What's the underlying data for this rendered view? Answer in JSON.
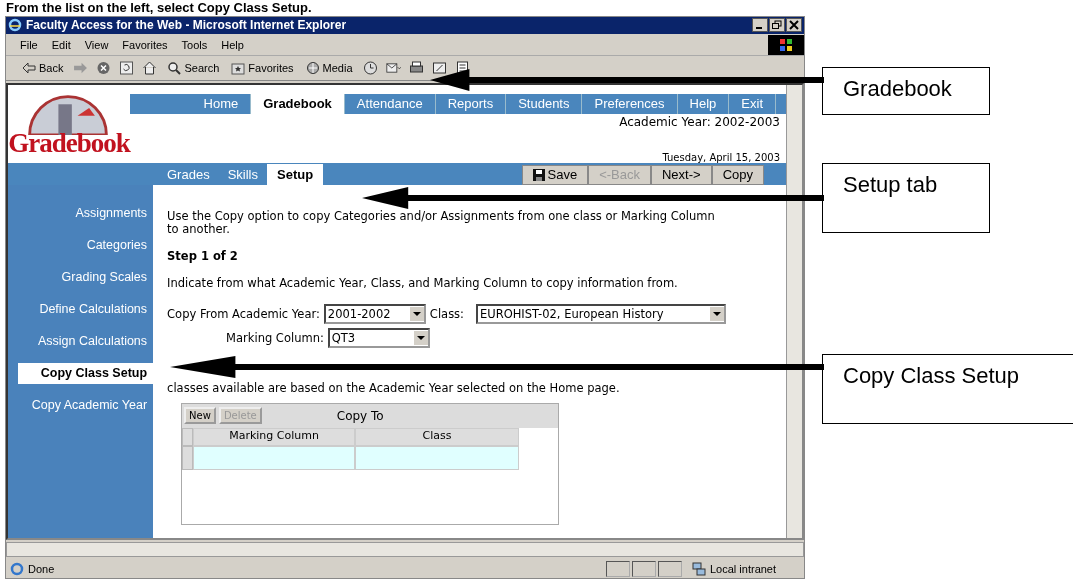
{
  "instruction": "From the list on the left, select **Copy Class Setup**.",
  "window": {
    "title": "Faculty Access for the Web - Microsoft Internet Explorer"
  },
  "menu": [
    "File",
    "Edit",
    "View",
    "Favorites",
    "Tools",
    "Help"
  ],
  "toolbar": [
    {
      "kind": "back",
      "label": "Back"
    },
    {
      "kind": "forward"
    },
    {
      "kind": "stop"
    },
    {
      "kind": "refresh"
    },
    {
      "kind": "home"
    },
    {
      "kind": "search",
      "label": "Search"
    },
    {
      "kind": "favorites",
      "label": "Favorites"
    },
    {
      "kind": "media",
      "label": "Media"
    },
    {
      "kind": "history"
    },
    {
      "kind": "mail"
    },
    {
      "kind": "print"
    },
    {
      "kind": "edit"
    },
    {
      "kind": "discuss"
    }
  ],
  "app": {
    "logo": "Gradebook",
    "nav": [
      {
        "label": "Home",
        "selected": false
      },
      {
        "label": "Gradebook",
        "selected": true
      },
      {
        "label": "Attendance",
        "selected": false
      },
      {
        "label": "Reports",
        "selected": false
      },
      {
        "label": "Students",
        "selected": false
      },
      {
        "label": "Preferences",
        "selected": false
      },
      {
        "label": "Help",
        "selected": false
      },
      {
        "label": "Exit",
        "selected": false
      }
    ],
    "academic_year": "Academic Year: 2002-2003",
    "date": "Tuesday, April 15, 2003",
    "subtabs": [
      {
        "label": "Grades",
        "selected": false
      },
      {
        "label": "Skills",
        "selected": false
      },
      {
        "label": "Setup",
        "selected": true
      }
    ],
    "actions": [
      {
        "kind": "save",
        "label": "Save",
        "disabled": false
      },
      {
        "kind": "text",
        "label": "<-Back",
        "disabled": true
      },
      {
        "kind": "text",
        "label": "Next->",
        "disabled": false
      },
      {
        "kind": "text",
        "label": "Copy",
        "disabled": false
      }
    ],
    "sidebar": [
      {
        "label": "Assignments",
        "selected": false
      },
      {
        "label": "Categories",
        "selected": false
      },
      {
        "label": "Grading Scales",
        "selected": false
      },
      {
        "label": "Define Calculations",
        "selected": false
      },
      {
        "label": "Assign Calculations",
        "selected": false
      },
      {
        "label": "Copy Class Setup",
        "selected": true
      },
      {
        "label": "Copy Academic Year",
        "selected": false
      }
    ],
    "intro": "Use the Copy option to copy Categories and/or Assignments from one class or Marking Column to another.",
    "step": "Step 1 of 2",
    "indicate": "Indicate from what Academic Year, Class, and Marking Column to copy information from.",
    "fields": [
      {
        "label": "Copy From Academic Year:",
        "value": "2001-2002"
      },
      {
        "label": "Class:",
        "value": "EUROHIST-02, European History"
      },
      {
        "label": "Marking Column:",
        "value": "QT3"
      }
    ],
    "note": "classes available are based on the Academic Year selected on the Home page.",
    "copy_to": {
      "title": "Copy To",
      "buttons": [
        {
          "label": "New",
          "disabled": false
        },
        {
          "label": "Delete",
          "disabled": true
        }
      ],
      "columns": [
        "Marking Column",
        "Class"
      ]
    }
  },
  "status": {
    "text": "Done",
    "zone": "Local intranet"
  },
  "callouts": [
    "Gradebook",
    "Setup tab",
    "Copy Class Setup"
  ]
}
